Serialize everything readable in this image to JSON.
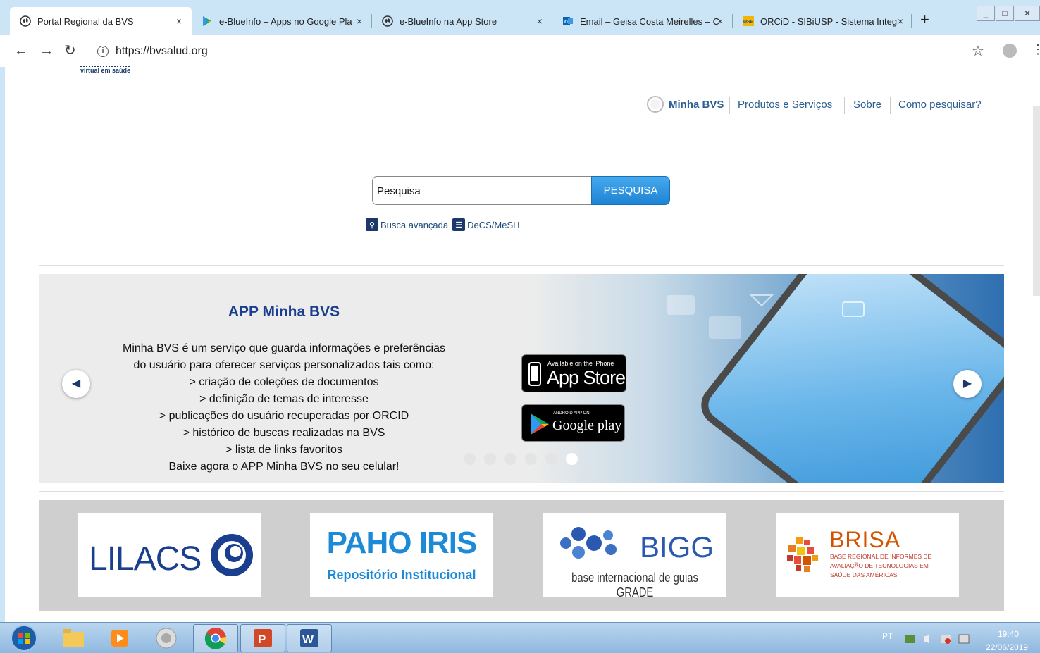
{
  "tabs": [
    {
      "label": "Portal Regional da BVS",
      "icon": "globe-icon",
      "close": "×"
    },
    {
      "label": "e-BlueInfo – Apps no Google Pla",
      "icon": "google-play-icon",
      "close": "×"
    },
    {
      "label": "e-BlueInfo na App Store",
      "icon": "globe-icon",
      "close": "×"
    },
    {
      "label": "Email – Geisa Costa Meirelles – C",
      "icon": "outlook-icon",
      "close": "×"
    },
    {
      "label": "ORCiD - SIBiUSP - Sistema Integ",
      "icon": "usp-icon",
      "close": "×"
    }
  ],
  "newtab": "+",
  "window_controls": [
    "_",
    "□",
    "✕"
  ],
  "address": {
    "url": "https://bvsalud.org"
  },
  "logo_text": "virtual em saúde",
  "topnav": {
    "minha": "Minha BVS",
    "produtos": "Produtos e Serviços",
    "sobre": "Sobre",
    "como": "Como pesquisar?"
  },
  "search": {
    "value": "Pesquisa",
    "button": "PESQUISA"
  },
  "links": {
    "advanced": "Busca avançada",
    "decs": "DeCS/MeSH"
  },
  "banner": {
    "title": "APP Minha BVS",
    "lines": [
      "Minha BVS é um serviço que guarda informações e preferências",
      "do usuário para oferecer serviços personalizados tais como:",
      "> criação de coleções de documentos",
      "> definição de temas de interesse",
      "> publicações do usuário recuperadas por ORCID",
      "> histórico de buscas realizadas na BVS",
      "> lista de links favoritos",
      "Baixe agora o APP Minha BVS no seu celular!"
    ],
    "appstore_small": "Available on the iPhone",
    "appstore_big": "App Store",
    "gplay_small": "ANDROID APP ON",
    "gplay_big": "Google play",
    "slide_count": 6,
    "active_slide": 6
  },
  "partners": {
    "lilacs": "LILACS",
    "paho_title": "PAHO IRIS",
    "paho_sub": "Repositório Institucional",
    "bigg_title": "BIGG",
    "bigg_sub": "base internacional de guias GRADE",
    "brisa_title": "BRISA",
    "brisa_sub1": "BASE REGIONAL DE INFORMES DE",
    "brisa_sub2": "AVALIAÇÃO DE TECNOLOGIAS EM",
    "brisa_sub3": "SAÚDE DAS AMÉRICAS"
  },
  "taskbar": {
    "lang": "PT",
    "time": "19:40",
    "date": "22/06/2019"
  },
  "colors": {
    "accent": "#1d84d4",
    "nav": "#2a5d8f",
    "brand": "#1b3f8f"
  }
}
